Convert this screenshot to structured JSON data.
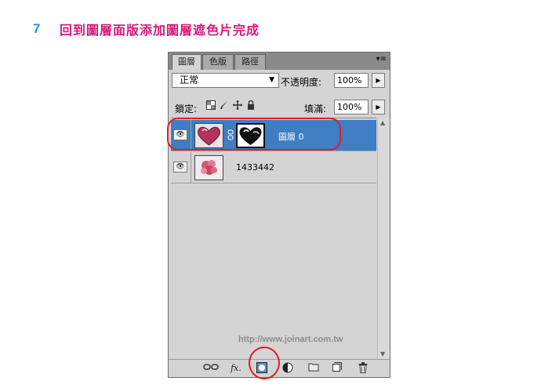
{
  "step": {
    "number": "7",
    "title": "回到圖層面版添加圖層遮色片完成"
  },
  "panel": {
    "tabs": [
      {
        "label": "圖層"
      },
      {
        "label": "色版"
      },
      {
        "label": "路徑"
      }
    ],
    "menu_icon": "panel-menu-icon",
    "blend_mode": "正常",
    "opacity_label": "不透明度:",
    "opacity_value": "100%",
    "lock_label": "鎖定:",
    "fill_label": "填滿:",
    "fill_value": "100%",
    "layers": [
      {
        "name": "圖層 0",
        "selected": true,
        "has_mask": true
      },
      {
        "name": "1433442",
        "selected": false,
        "has_mask": false
      }
    ],
    "watermark": "http://www.joinart.com.tw",
    "bottom_icons": [
      "link-layers-icon",
      "fx-icon",
      "add-mask-icon",
      "adjustment-layer-icon",
      "new-group-icon",
      "new-layer-icon",
      "trash-icon"
    ]
  },
  "colors": {
    "title": "#d6187a",
    "number": "#1e9ad6",
    "selection": "#3f7ec2",
    "callout": "#e02020"
  }
}
